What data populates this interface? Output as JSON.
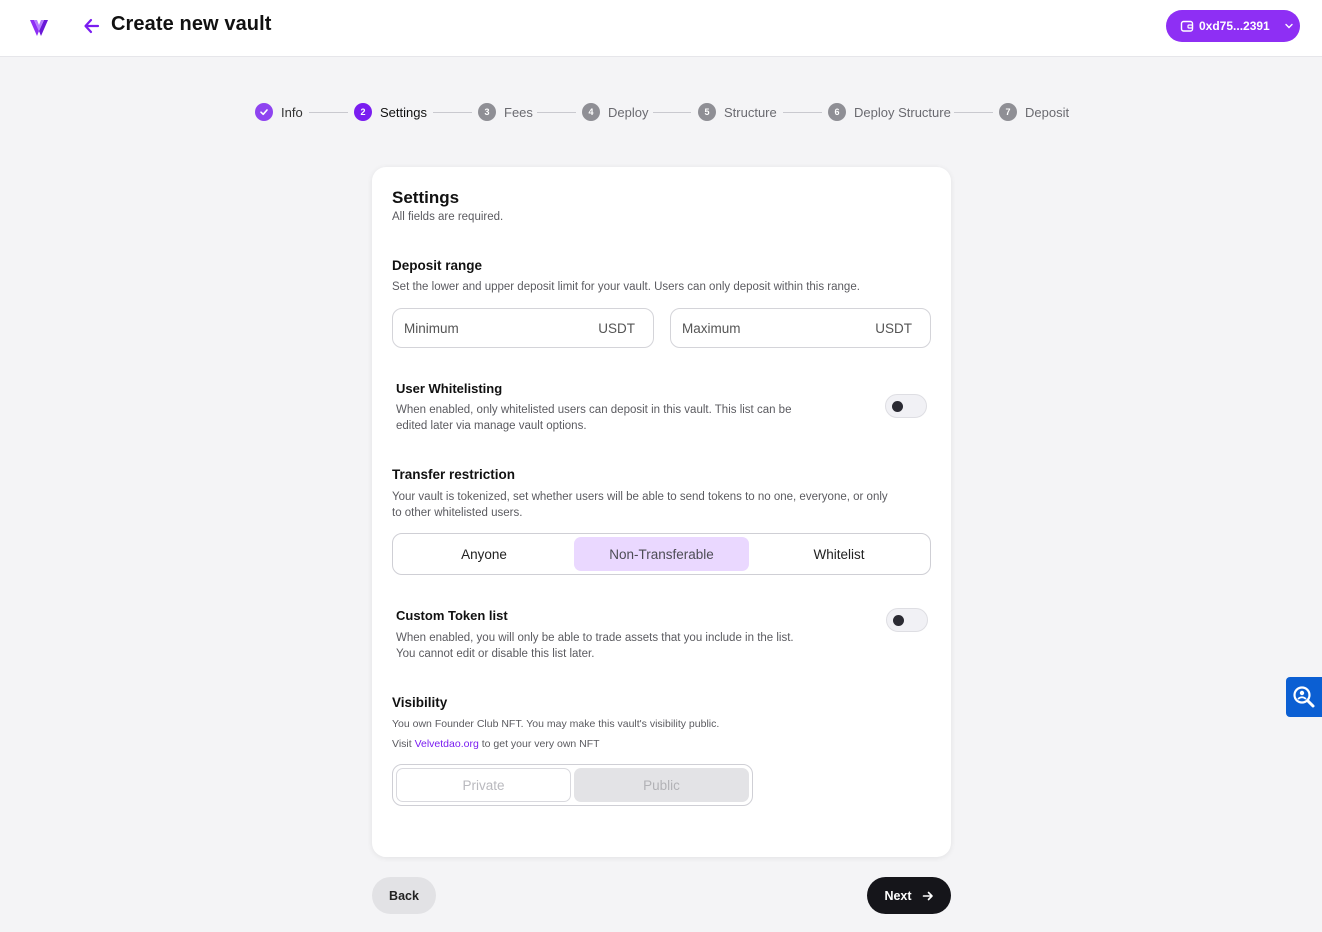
{
  "header": {
    "title": "Create new vault",
    "wallet_label": "0xd75...2391",
    "brand_color": "#8e2ff4"
  },
  "stepper": {
    "steps": [
      {
        "number": "",
        "label": "Info",
        "state": "done"
      },
      {
        "number": "2",
        "label": "Settings",
        "state": "active"
      },
      {
        "number": "3",
        "label": "Fees",
        "state": "pending"
      },
      {
        "number": "4",
        "label": "Deploy",
        "state": "pending"
      },
      {
        "number": "5",
        "label": "Structure",
        "state": "pending"
      },
      {
        "number": "6",
        "label": "Deploy Structure",
        "state": "pending"
      },
      {
        "number": "7",
        "label": "Deposit",
        "state": "pending"
      }
    ]
  },
  "card": {
    "title": "Settings",
    "subtitle": "All fields are required.",
    "deposit_range": {
      "title": "Deposit range",
      "description": "Set the lower and upper deposit limit for your vault. Users can only deposit within this range.",
      "min_placeholder": "Minimum",
      "min_unit": "USDT",
      "max_placeholder": "Maximum",
      "max_unit": "USDT"
    },
    "user_whitelisting": {
      "title": "User Whitelisting",
      "description_line1": "When enabled, only whitelisted users can deposit in this vault. This list can be",
      "description_line2": "edited later via manage vault options.",
      "enabled": false
    },
    "transfer_restriction": {
      "title": "Transfer restriction",
      "description_line1": "Your vault is tokenized, set whether users will be able to send tokens to no one, everyone, or only",
      "description_line2": "to other whitelisted users.",
      "options": [
        "Anyone",
        "Non-Transferable",
        "Whitelist"
      ],
      "selected": "Non-Transferable"
    },
    "custom_token_list": {
      "title": "Custom Token list",
      "description_line1": "When enabled, you will only be able to trade assets that you include in the list.",
      "description_line2": "You cannot edit or disable this list later.",
      "enabled": false
    },
    "visibility": {
      "title": "Visibility",
      "description": "You own Founder Club NFT. You may make this vault's visibility public.",
      "visit_prefix": "Visit",
      "link_text": "Velvetdao.org",
      "visit_suffix": "to get your very own NFT",
      "options": [
        "Private",
        "Public"
      ]
    }
  },
  "footer": {
    "back_label": "Back",
    "next_label": "Next"
  }
}
